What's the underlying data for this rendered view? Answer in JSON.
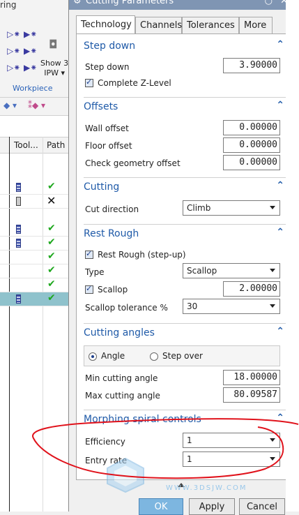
{
  "background": {
    "title_fragment": "ring",
    "show3_label": "Show 3",
    "ipw_label": "IPW ▾",
    "workpiece_label": "Workpiece",
    "grid_headers": {
      "tool": "Tool...",
      "path": "Path"
    },
    "rows": [
      {
        "status": "check"
      },
      {
        "status": "cross"
      },
      {
        "status": "check"
      },
      {
        "status": "check"
      },
      {
        "status": "check"
      },
      {
        "status": "check"
      },
      {
        "status": "check"
      },
      {
        "status": "check"
      }
    ]
  },
  "dialog": {
    "title": "Cutting Parameters",
    "tabs": [
      "Technology",
      "Channels",
      "Tolerances",
      "More"
    ],
    "active_tab": "Technology",
    "sections": {
      "step_down": {
        "title": "Step down",
        "step_down_label": "Step down",
        "step_down_value": "3.90000",
        "complete_z_label": "Complete Z-Level",
        "complete_z_checked": true
      },
      "offsets": {
        "title": "Offsets",
        "wall_offset_label": "Wall offset",
        "wall_offset_value": "0.00000",
        "floor_offset_label": "Floor offset",
        "floor_offset_value": "0.00000",
        "check_geometry_offset_label": "Check geometry offset",
        "check_geometry_offset_value": "0.00000"
      },
      "cutting": {
        "title": "Cutting",
        "cut_direction_label": "Cut direction",
        "cut_direction_value": "Climb"
      },
      "rest_rough": {
        "title": "Rest Rough",
        "rest_rough_label": "Rest Rough (step-up)",
        "rest_rough_checked": true,
        "type_label": "Type",
        "type_value": "Scallop",
        "scallop_label": "Scallop",
        "scallop_checked": true,
        "scallop_value": "2.00000",
        "scallop_tol_label": "Scallop tolerance %",
        "scallop_tol_value": "30"
      },
      "cutting_angles": {
        "title": "Cutting angles",
        "angle_label": "Angle",
        "step_over_label": "Step over",
        "selected": "Angle",
        "min_angle_label": "Min cutting angle",
        "min_angle_value": "18.00000",
        "max_angle_label": "Max cutting angle",
        "max_angle_value": "80.09587"
      },
      "morphing": {
        "title": "Morphing spiral controls",
        "efficiency_label": "Efficiency",
        "efficiency_value": "1",
        "entry_rate_label": "Entry rate",
        "entry_rate_value": "1"
      }
    },
    "buttons": {
      "ok": "OK",
      "apply": "Apply",
      "cancel": "Cancel"
    }
  },
  "watermark_text": "WWW.3DSJW.COM",
  "colors": {
    "accent": "#1f5aa8",
    "selection": "#8fc2cc",
    "annotation": "#e0121b"
  }
}
